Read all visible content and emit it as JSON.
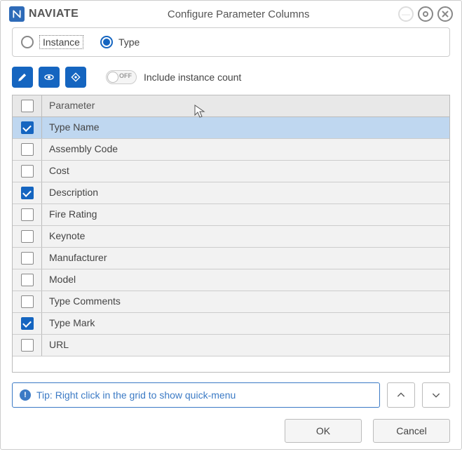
{
  "brand": "NAVIATE",
  "window_title": "Configure Parameter Columns",
  "mode": {
    "options": [
      {
        "label": "Instance",
        "selected": false
      },
      {
        "label": "Type",
        "selected": true
      }
    ]
  },
  "toggle": {
    "state_label": "OFF",
    "text": "Include instance count"
  },
  "grid": {
    "header_check": false,
    "header_label": "Parameter",
    "rows": [
      {
        "label": "Type Name",
        "checked": true,
        "selected": true
      },
      {
        "label": "Assembly Code",
        "checked": false,
        "selected": false
      },
      {
        "label": "Cost",
        "checked": false,
        "selected": false
      },
      {
        "label": "Description",
        "checked": true,
        "selected": false
      },
      {
        "label": "Fire Rating",
        "checked": false,
        "selected": false
      },
      {
        "label": "Keynote",
        "checked": false,
        "selected": false
      },
      {
        "label": "Manufacturer",
        "checked": false,
        "selected": false
      },
      {
        "label": "Model",
        "checked": false,
        "selected": false
      },
      {
        "label": "Type Comments",
        "checked": false,
        "selected": false
      },
      {
        "label": "Type Mark",
        "checked": true,
        "selected": false
      },
      {
        "label": "URL",
        "checked": false,
        "selected": false
      }
    ]
  },
  "tip": "Tip: Right click in the grid to show quick-menu",
  "buttons": {
    "ok": "OK",
    "cancel": "Cancel"
  }
}
